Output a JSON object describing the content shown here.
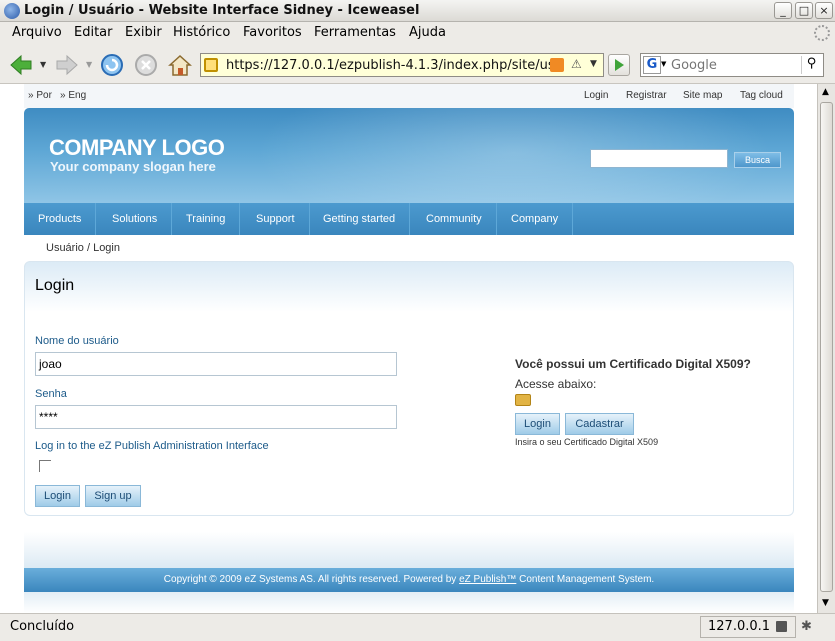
{
  "window": {
    "title": "Login / Usuário - Website Interface Sidney - Iceweasel"
  },
  "menu": [
    "Arquivo",
    "Editar",
    "Exibir",
    "Histórico",
    "Favoritos",
    "Ferramentas",
    "Ajuda"
  ],
  "nav": {
    "url": "https://127.0.0.1/ezpublish-4.1.3/index.php/site/us",
    "search_placeholder": "Google"
  },
  "page": {
    "languages": [
      "Por",
      "Eng"
    ],
    "top_links": [
      "Login",
      "Registrar",
      "Site map",
      "Tag cloud"
    ],
    "logo": "COMPANY LOGO",
    "slogan": "Your company slogan here",
    "search_button": "Busca",
    "search_value": "",
    "nav_items": [
      "Products",
      "Solutions",
      "Training",
      "Support",
      "Getting started",
      "Community",
      "Company"
    ],
    "breadcrumb": "Usuário / Login",
    "title": "Login",
    "username_label": "Nome do usuário",
    "username_value": "joao",
    "password_label": "Senha",
    "password_value": "****",
    "admin_label": "Log in to the eZ Publish Administration Interface",
    "login_button": "Login",
    "signup_button": "Sign up",
    "cert_title_bold": "Você possui um Certificado Digital X509?",
    "cert_title_rest": " Acesse abaixo:",
    "cert_login_button": "Login",
    "cert_register_button": "Cadastrar",
    "cert_note": "Insira o seu Certificado Digital X509",
    "footer_before": "Copyright © 2009 eZ Systems AS. All rights reserved. Powered by ",
    "footer_link": "eZ Publish™",
    "footer_after": " Content Management System."
  },
  "status": {
    "text": "Concluído",
    "host": "127.0.0.1"
  }
}
